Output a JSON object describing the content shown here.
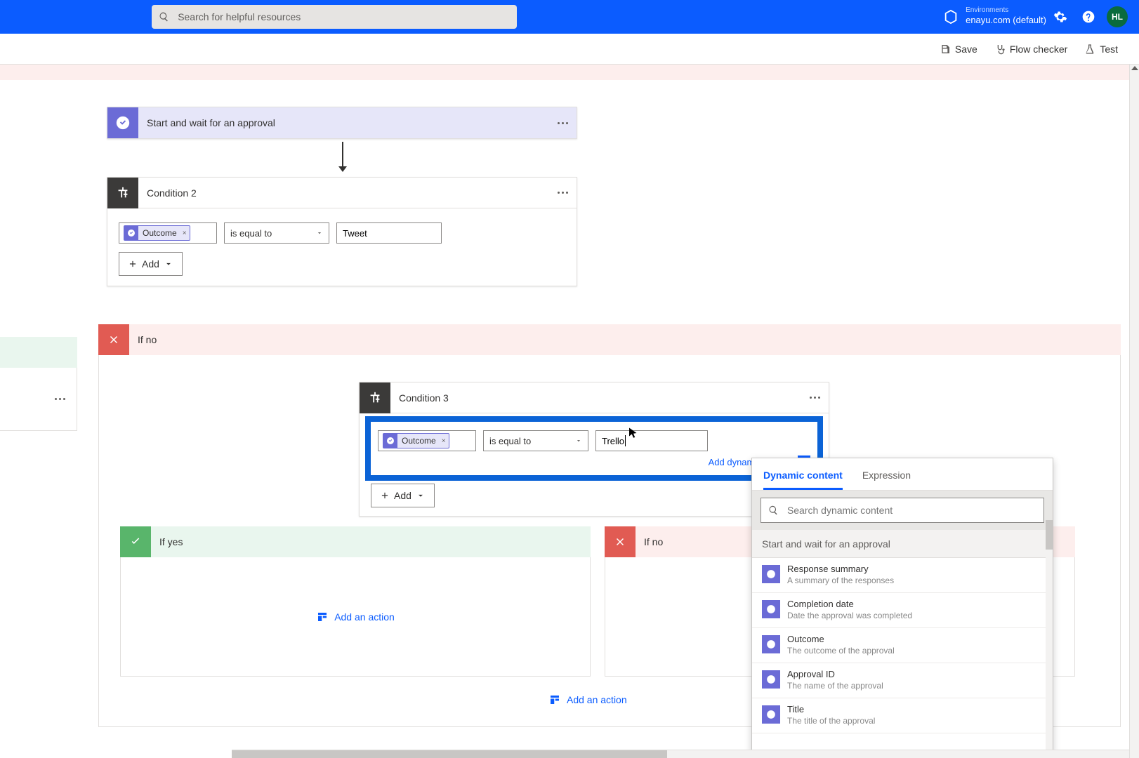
{
  "search": {
    "placeholder": "Search for helpful resources"
  },
  "environments_label": "Environments",
  "environment_name": "enayu.com (default)",
  "user_initials": "HL",
  "toolbar": {
    "save": "Save",
    "flow_checker": "Flow checker",
    "test": "Test"
  },
  "approval_card": {
    "title": "Start and wait for an approval"
  },
  "condition2": {
    "title": "Condition 2",
    "token": "Outcome",
    "operator": "is equal to",
    "value": "Tweet",
    "add_label": "Add"
  },
  "ifno_label": "If no",
  "ifyes_label": "If yes",
  "condition3": {
    "title": "Condition 3",
    "token": "Outcome",
    "operator": "is equal to",
    "value": "Trello",
    "add_dyn": "Add dynamic content",
    "add_label": "Add"
  },
  "add_action_label": "Add an action",
  "popover": {
    "tab_dynamic": "Dynamic content",
    "tab_expression": "Expression",
    "search_placeholder": "Search dynamic content",
    "section": "Start and wait for an approval",
    "items": [
      {
        "name": "Response summary",
        "desc": "A summary of the responses"
      },
      {
        "name": "Completion date",
        "desc": "Date the approval was completed"
      },
      {
        "name": "Outcome",
        "desc": "The outcome of the approval"
      },
      {
        "name": "Approval ID",
        "desc": "The name of the approval"
      },
      {
        "name": "Title",
        "desc": "The title of the approval"
      }
    ]
  }
}
